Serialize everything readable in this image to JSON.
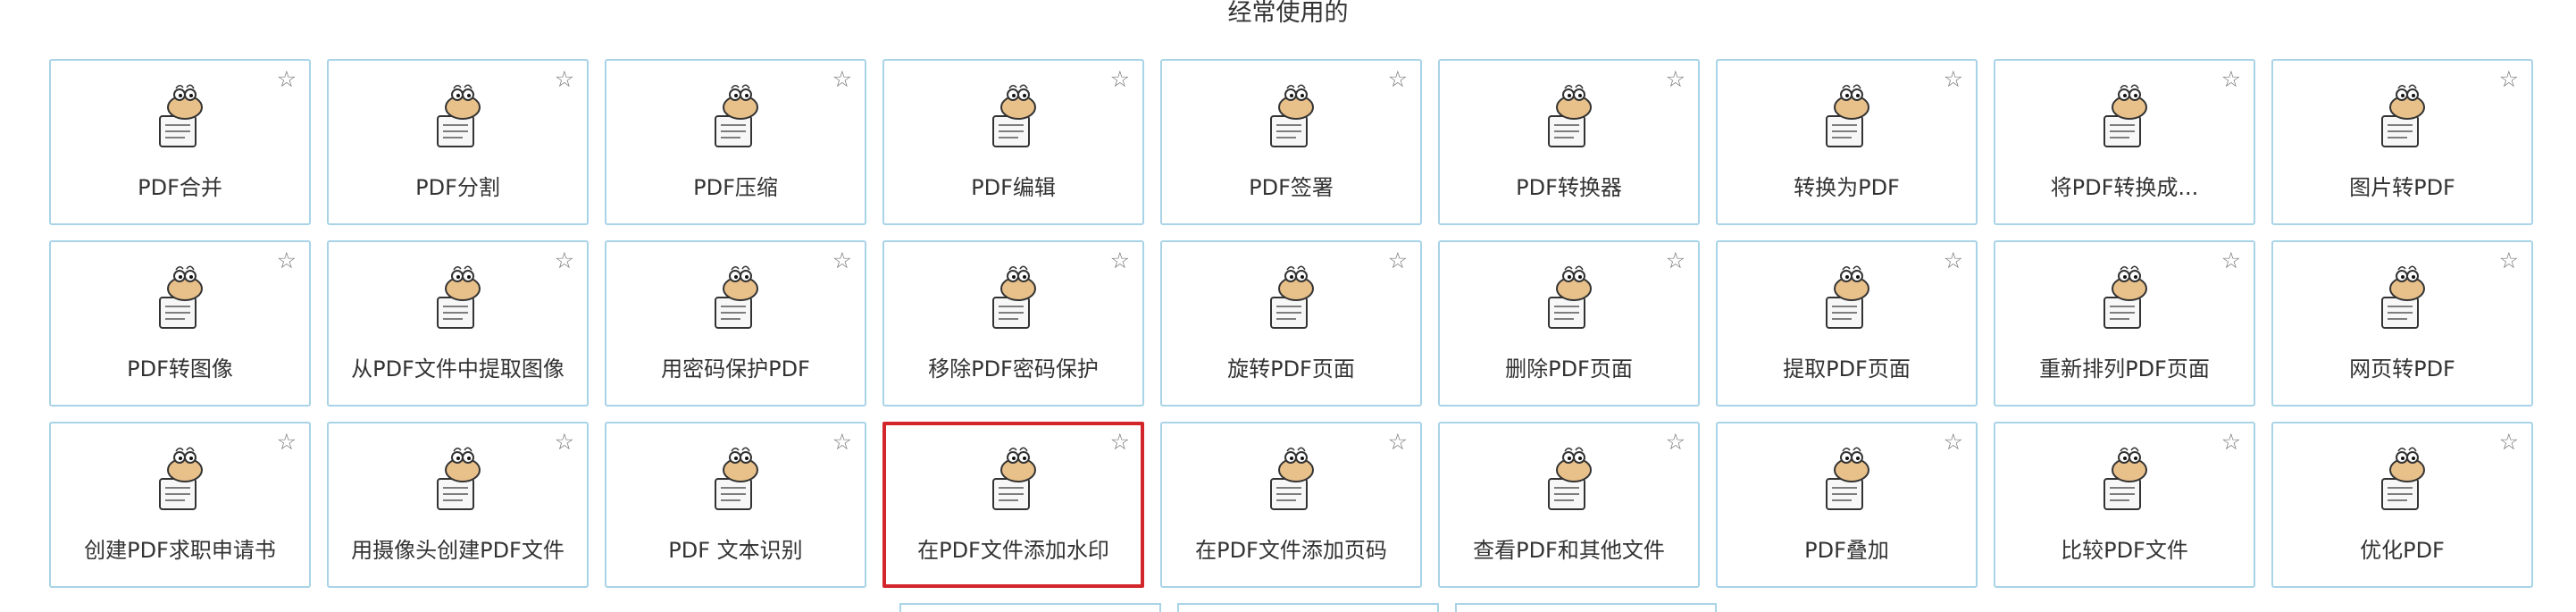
{
  "section_title": "经常使用的",
  "tiles": [
    {
      "label": "PDF合并",
      "icon": "merge-icon"
    },
    {
      "label": "PDF分割",
      "icon": "split-icon"
    },
    {
      "label": "PDF压缩",
      "icon": "compress-icon"
    },
    {
      "label": "PDF编辑",
      "icon": "edit-icon"
    },
    {
      "label": "PDF签署",
      "icon": "sign-icon"
    },
    {
      "label": "PDF转换器",
      "icon": "converter-icon"
    },
    {
      "label": "转换为PDF",
      "icon": "convert-to-pdf-icon"
    },
    {
      "label": "将PDF转换成...",
      "icon": "convert-from-pdf-icon"
    },
    {
      "label": "图片转PDF",
      "icon": "image-to-pdf-icon"
    },
    {
      "label": "PDF转图像",
      "icon": "pdf-to-image-icon"
    },
    {
      "label": "从PDF文件中提取图像",
      "icon": "extract-images-icon"
    },
    {
      "label": "用密码保护PDF",
      "icon": "protect-icon"
    },
    {
      "label": "移除PDF密码保护",
      "icon": "unlock-icon"
    },
    {
      "label": "旋转PDF页面",
      "icon": "rotate-icon"
    },
    {
      "label": "删除PDF页面",
      "icon": "delete-pages-icon"
    },
    {
      "label": "提取PDF页面",
      "icon": "extract-pages-icon"
    },
    {
      "label": "重新排列PDF页面",
      "icon": "reorder-pages-icon"
    },
    {
      "label": "网页转PDF",
      "icon": "webpage-to-pdf-icon"
    },
    {
      "label": "创建PDF求职申请书",
      "icon": "application-icon"
    },
    {
      "label": "用摄像头创建PDF文件",
      "icon": "camera-icon"
    },
    {
      "label": "PDF 文本识别",
      "icon": "ocr-icon"
    },
    {
      "label": "在PDF文件添加水印",
      "icon": "watermark-icon"
    },
    {
      "label": "在PDF文件添加页码",
      "icon": "page-numbers-icon"
    },
    {
      "label": "查看PDF和其他文件",
      "icon": "viewer-icon"
    },
    {
      "label": "PDF叠加",
      "icon": "overlay-icon"
    },
    {
      "label": "比较PDF文件",
      "icon": "compare-icon"
    },
    {
      "label": "优化PDF",
      "icon": "optimize-icon"
    }
  ],
  "selected_index": 21,
  "star_glyph": "☆",
  "colors": {
    "border": "#a9d3e7",
    "selected_border": "#d3262b",
    "mascot": "#e8c08a"
  }
}
